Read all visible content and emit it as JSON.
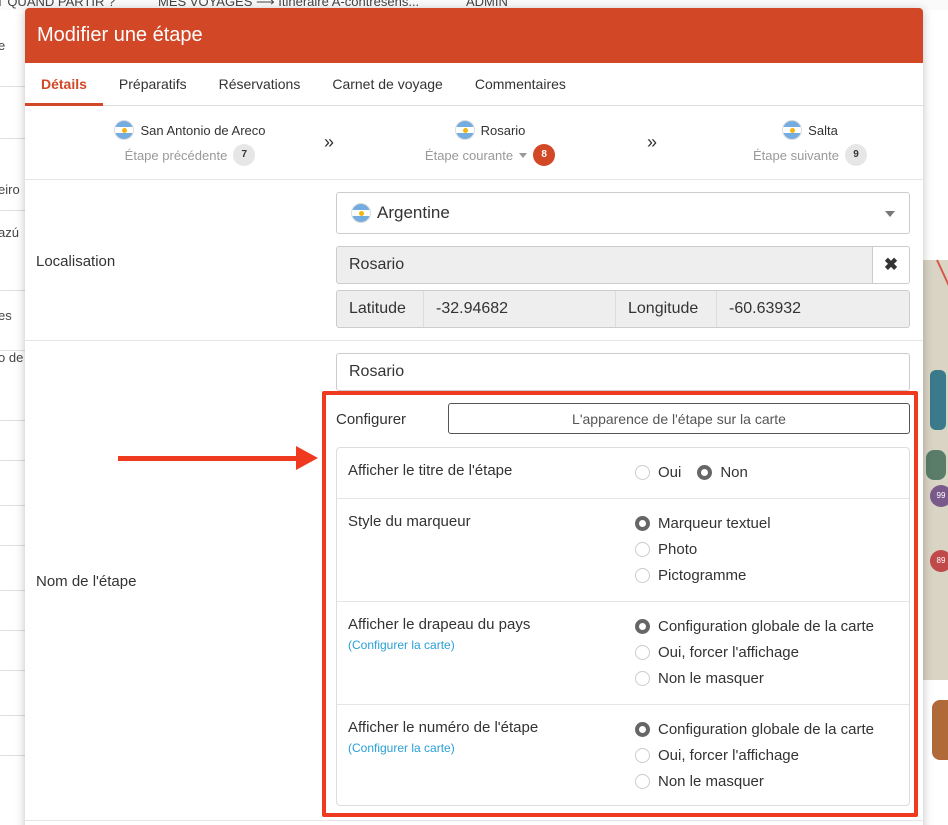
{
  "background": {
    "topbar": [
      "T QUAND PARTIR ?",
      "MES VOYAGES ⟶ Itinéraire A-contresens...",
      "ADMIN"
    ],
    "left_fragments": [
      "e",
      "eiro",
      "azú",
      "es",
      "o de"
    ],
    "map_pins": [
      "99",
      "89"
    ]
  },
  "modal": {
    "title": "Modifier une étape",
    "tabs": [
      "Détails",
      "Préparatifs",
      "Réservations",
      "Carnet de voyage",
      "Commentaires"
    ]
  },
  "steps": {
    "previous": {
      "name": "San Antonio de Areco",
      "label": "Étape précédente",
      "number": "7"
    },
    "current": {
      "name": "Rosario",
      "label": "Étape courante",
      "number": "8"
    },
    "next": {
      "name": "Salta",
      "label": "Étape suivante",
      "number": "9"
    },
    "separator": "»"
  },
  "location": {
    "label": "Localisation",
    "country": "Argentine",
    "city": "Rosario",
    "clear_icon": "✖",
    "latitude_label": "Latitude",
    "latitude": "-32.94682",
    "longitude_label": "Longitude",
    "longitude": "-60.63932"
  },
  "step_name": {
    "label": "Nom de l'étape",
    "value": "Rosario",
    "configurer_label": "Configurer",
    "configurer_button": "L'apparence de l'étape sur la carte"
  },
  "options": {
    "show_title": {
      "label": "Afficher le titre de l'étape",
      "choices": [
        "Oui",
        "Non"
      ],
      "selected": 1
    },
    "marker_style": {
      "label": "Style du marqueur",
      "choices": [
        "Marqueur textuel",
        "Photo",
        "Pictogramme"
      ],
      "selected": 0
    },
    "show_flag": {
      "label": "Afficher le drapeau du pays",
      "link": "(Configurer la carte)",
      "choices": [
        "Configuration globale de la carte",
        "Oui, forcer l'affichage",
        "Non le masquer"
      ],
      "selected": 0
    },
    "show_number": {
      "label": "Afficher le numéro de l'étape",
      "link": "(Configurer la carte)",
      "choices": [
        "Configuration globale de la carte",
        "Oui, forcer l'affichage",
        "Non le masquer"
      ],
      "selected": 0
    }
  },
  "colors": {
    "header": "#d24726",
    "annotation": "#ef3a1f",
    "link": "#2a9fd6"
  }
}
